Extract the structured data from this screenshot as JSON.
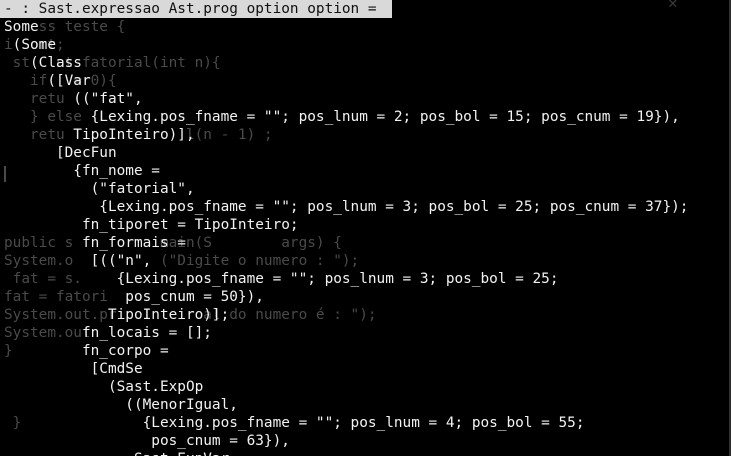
{
  "title_bar": {
    "text": "- : Sast.expressao Ast.prog option option ="
  },
  "background_editor": {
    "close_glyph": "✕",
    "lines": [
      "    ss teste {",
      "i  ort;",
      " st   nt fatorial(int n){",
      "   if   = 0){",
      "   retu",
      "   } else",
      "   retu              l(n - 1) ;",
      "",
      "",
      "",
      "",
      "",
      "public s          main(S        args) {",
      "System.o          (\"Digite o numero : \");",
      " fat = s.",
      "fat = fatori",
      "System.out.pr          al do numero é : \");",
      "System.out",
      "}",
      "",
      "",
      "",
      " }"
    ]
  },
  "output": {
    "lines": [
      "Some",
      " (Some",
      "   (Class",
      "     ([Var",
      "        ((\"fat\",",
      "          {Lexing.pos_fname = \"\"; pos_lnum = 2; pos_bol = 15; pos_cnum = 19}),",
      "        TipoInteiro)],",
      "      [DecFun",
      "        {fn_nome =",
      "          (\"fatorial\",",
      "           {Lexing.pos_fname = \"\"; pos_lnum = 3; pos_bol = 25; pos_cnum = 37});",
      "         fn_tiporet = TipoInteiro;",
      "         fn_formais =",
      "          [((\"n\",",
      "             {Lexing.pos_fname = \"\"; pos_lnum = 3; pos_bol = 25;",
      "              pos_cnum = 50}),",
      "            TipoInteiro)];",
      "         fn_locais = [];",
      "         fn_corpo =",
      "          [CmdSe",
      "            (Sast.ExpOp",
      "              ((MenorIgual,",
      "                {Lexing.pos_fname = \"\"; pos_lnum = 4; pos_bol = 55;",
      "                 pos_cnum = 63}),",
      "               Sast.ExpVar"
    ]
  }
}
